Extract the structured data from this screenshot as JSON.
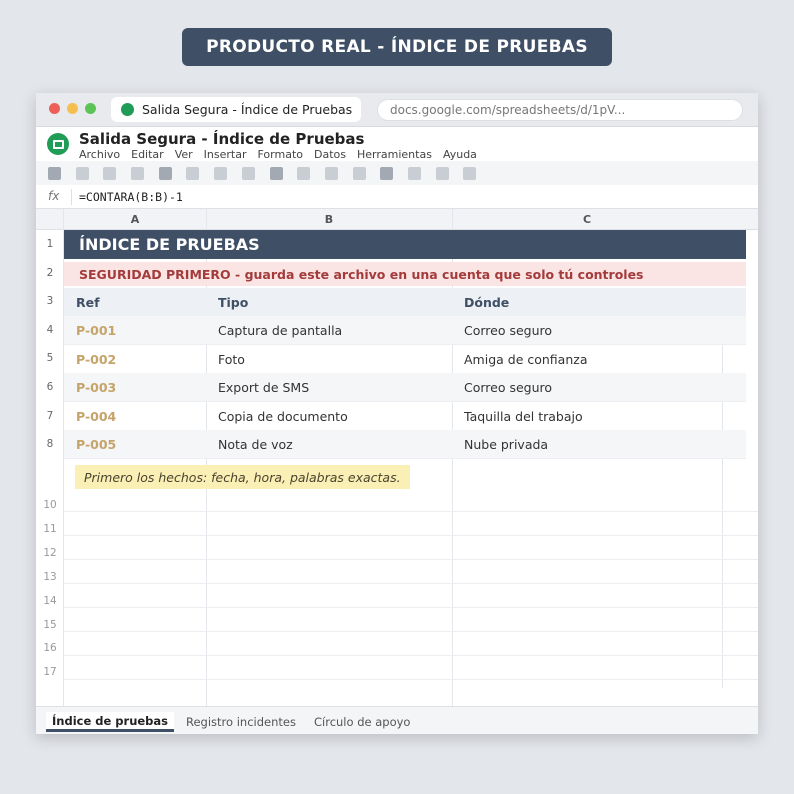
{
  "banner": "PRODUCTO REAL - ÍNDICE DE PRUEBAS",
  "browser": {
    "tab_title": "Salida Segura - Índice de Pruebas",
    "url": "docs.google.com/spreadsheets/d/1pV..."
  },
  "app": {
    "doc_title": "Salida Segura - Índice de Pruebas",
    "menu": [
      "Archivo",
      "Editar",
      "Ver",
      "Insertar",
      "Formato",
      "Datos",
      "Herramientas",
      "Ayuda"
    ]
  },
  "formula_bar": {
    "fx_label": "fx",
    "formula": "=CONTARA(B:B)-1"
  },
  "columns": [
    "A",
    "B",
    "C"
  ],
  "row_numbers": [
    "1",
    "2",
    "3",
    "4",
    "5",
    "6",
    "7",
    "8",
    "10",
    "11",
    "12",
    "13",
    "14",
    "15",
    "16",
    "17"
  ],
  "sheet": {
    "title": "ÍNDICE DE PRUEBAS",
    "warning": "SEGURIDAD PRIMERO - guarda este archivo en una cuenta que solo tú controles",
    "headers": [
      "Ref",
      "Tipo",
      "Dónde"
    ],
    "rows": [
      [
        "P-001",
        "Captura de pantalla",
        "Correo seguro"
      ],
      [
        "P-002",
        "Foto",
        "Amiga de confianza"
      ],
      [
        "P-003",
        "Export de SMS",
        "Correo seguro"
      ],
      [
        "P-004",
        "Copia de documento",
        "Taquilla del trabajo"
      ],
      [
        "P-005",
        "Nota de voz",
        "Nube privada"
      ]
    ],
    "note": "Primero los hechos: fecha, hora, palabras exactas."
  },
  "sheet_tabs": [
    "Índice de pruebas",
    "Registro incidentes",
    "Círculo de apoyo"
  ]
}
